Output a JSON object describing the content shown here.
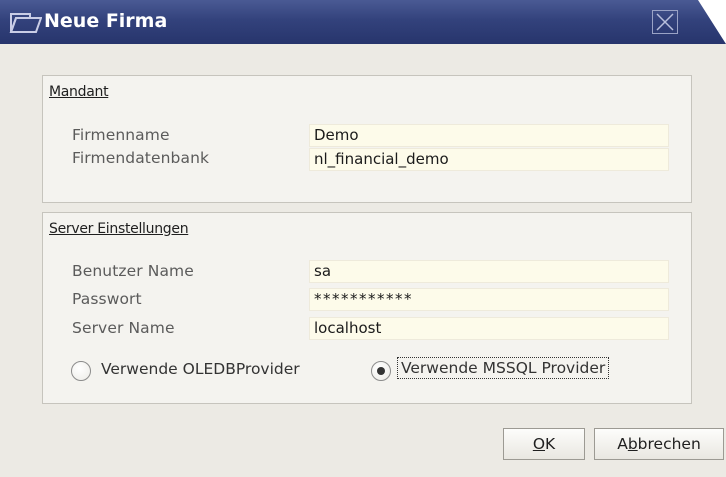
{
  "dialog": {
    "title": "Neue Firma"
  },
  "mandant": {
    "title": "Mandant",
    "fields": [
      {
        "label": "Firmenname",
        "value": "Demo"
      },
      {
        "label": "Firmendatenbank",
        "value": "nl_financial_demo"
      }
    ]
  },
  "server": {
    "title": "Server Einstellungen",
    "fields": [
      {
        "label": "Benutzer Name",
        "value": "sa"
      },
      {
        "label": "Passwort",
        "value": "***********"
      },
      {
        "label": "Server Name",
        "value": "localhost"
      }
    ],
    "options": [
      {
        "label": "Verwende OLEDBProvider",
        "selected": false
      },
      {
        "label": "Verwende MSSQL Provider",
        "selected": true
      }
    ]
  },
  "buttons": {
    "ok": {
      "accel": "O",
      "rest": "K"
    },
    "cancel": {
      "pre": "A",
      "accel": "b",
      "rest": "brechen"
    }
  },
  "colors": {
    "titlebar": "#33427c",
    "field_bg": "#fdfbea",
    "panel_bg": "#f4f3ef",
    "window_bg": "#eceae4"
  }
}
